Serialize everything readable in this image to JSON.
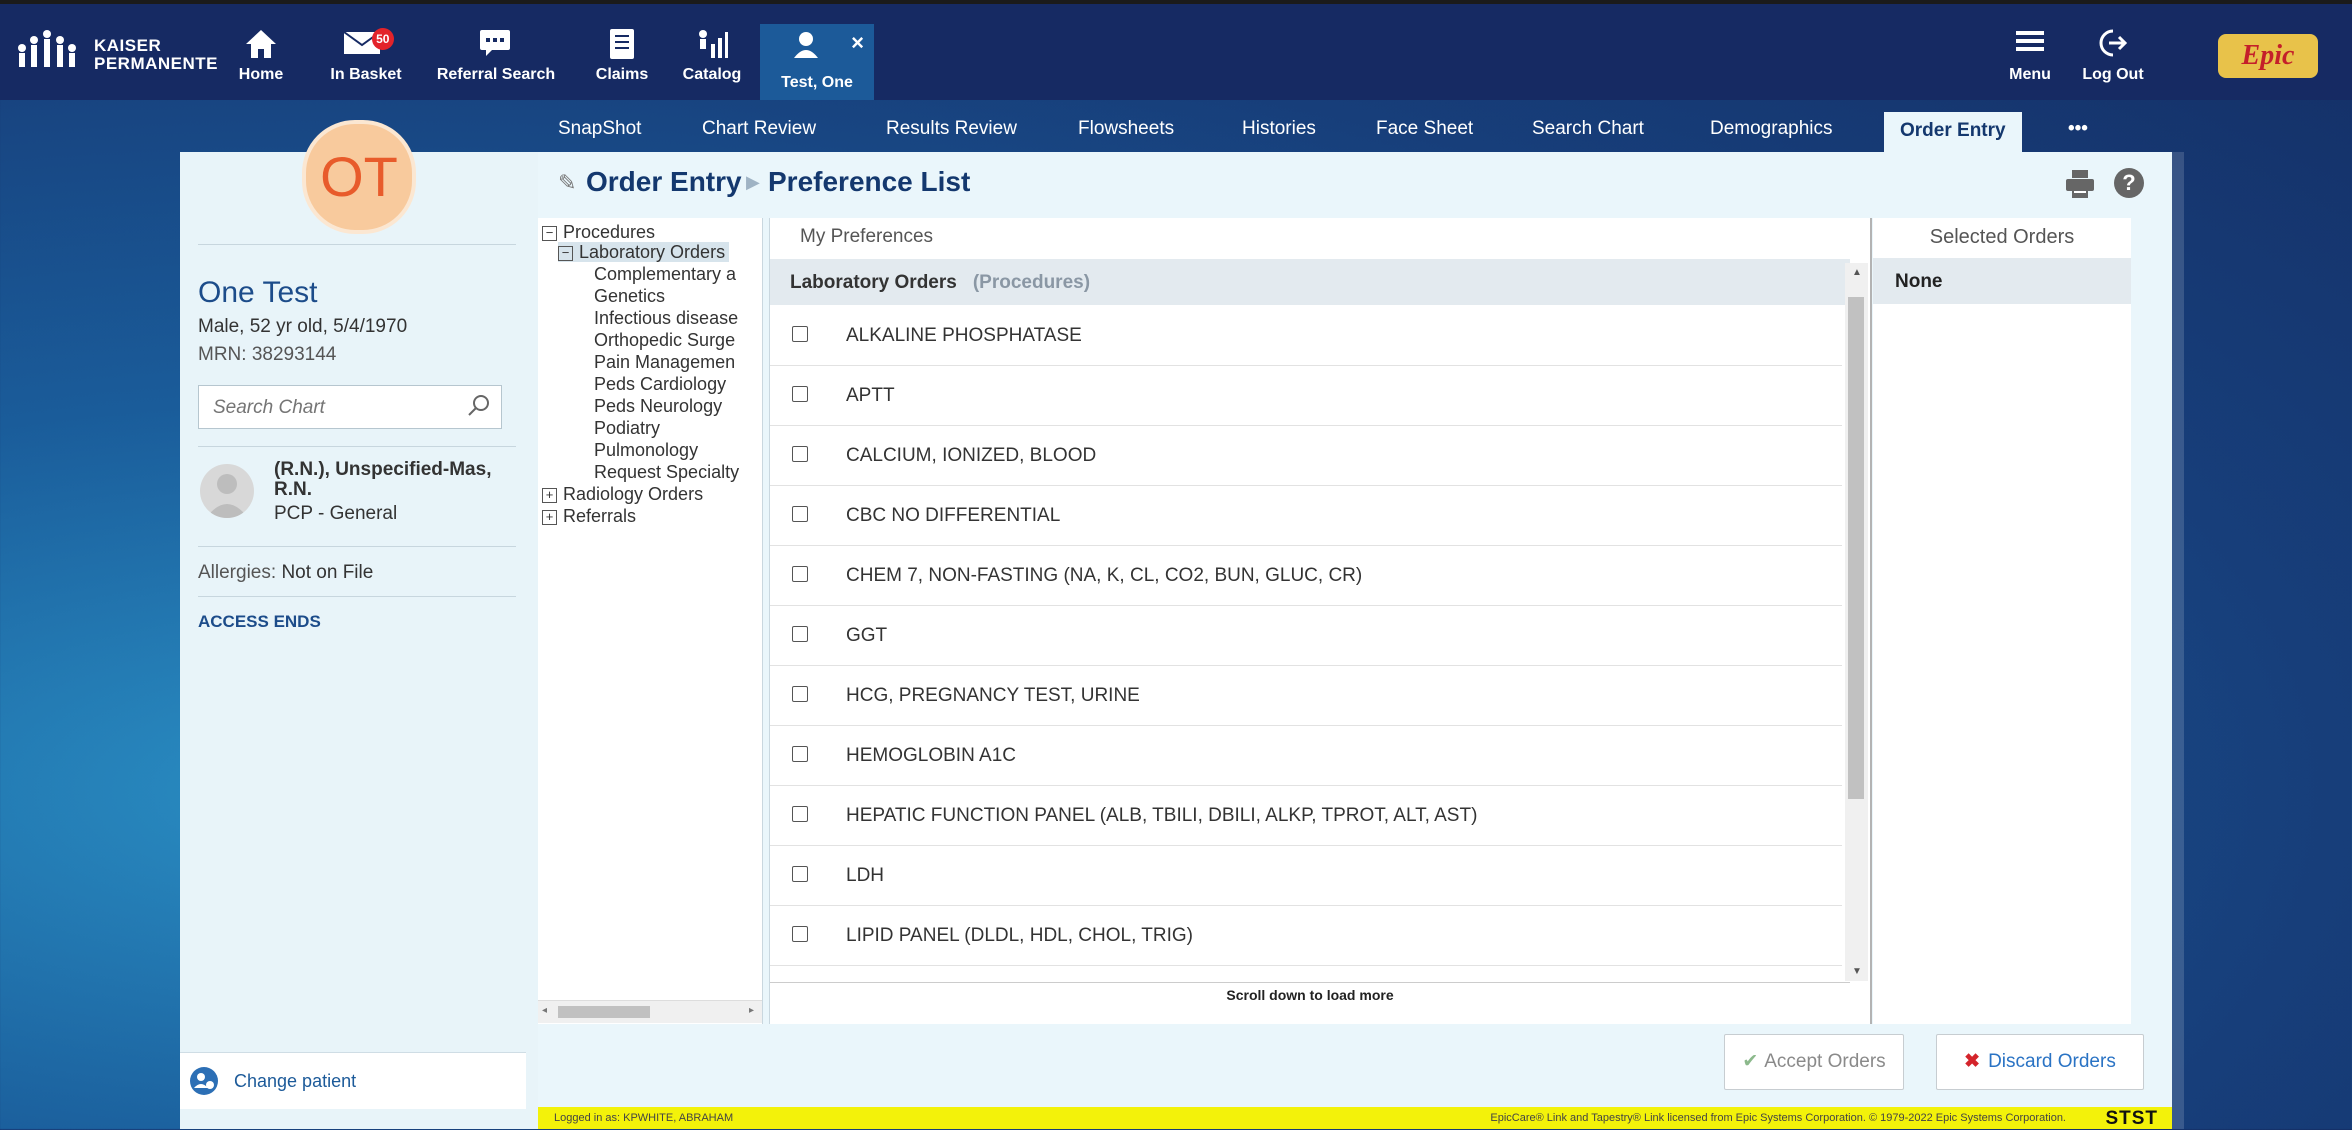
{
  "logo": {
    "line1": "KAISER",
    "line2": "PERMANENTE"
  },
  "topnav": {
    "home": "Home",
    "in_basket": "In Basket",
    "in_basket_count": "50",
    "referral_search": "Referral Search",
    "claims": "Claims",
    "catalog": "Catalog",
    "patient_tab": "Test, One",
    "menu": "Menu",
    "log_out": "Log Out",
    "epic": "Epic"
  },
  "tabs": [
    "SnapShot",
    "Chart Review",
    "Results Review",
    "Flowsheets",
    "Histories",
    "Face Sheet",
    "Search Chart",
    "Demographics",
    "Order Entry",
    "•••"
  ],
  "patient": {
    "initials": "OT",
    "name": "One Test",
    "demographics": "Male, 52 yr old, 5/4/1970",
    "mrn": "MRN: 38293144",
    "search_placeholder": "Search Chart",
    "pcp_name": "(R.N.), Unspecified-Mas, R.N.",
    "pcp_role": "PCP - General",
    "allergies_label": "Allergies:",
    "allergies_value": "Not on File",
    "access_ends": "ACCESS ENDS",
    "change_patient": "Change patient"
  },
  "breadcrumb": {
    "root": "Order Entry",
    "current": "Preference List"
  },
  "tree": {
    "procedures": "Procedures",
    "laboratory_orders": "Laboratory Orders",
    "children": [
      "Complementary a",
      "Genetics",
      "Infectious disease",
      "Orthopedic Surge",
      "Pain Managemen",
      "Peds Cardiology",
      "Peds Neurology",
      "Podiatry",
      "Pulmonology",
      "Request Specialty"
    ],
    "radiology_orders": "Radiology Orders",
    "referrals": "Referrals"
  },
  "list": {
    "my_preferences": "My Preferences",
    "header": "Laboratory Orders",
    "header_sub": "(Procedures)",
    "items": [
      "ALKALINE PHOSPHATASE",
      "APTT",
      "CALCIUM, IONIZED, BLOOD",
      "CBC NO DIFFERENTIAL",
      "CHEM 7, NON-FASTING (NA, K, CL, CO2, BUN, GLUC, CR)",
      "GGT",
      "HCG, PREGNANCY TEST, URINE",
      "HEMOGLOBIN A1C",
      "HEPATIC FUNCTION PANEL (ALB, TBILI, DBILI, ALKP, TPROT, ALT, AST)",
      "LDH",
      "LIPID PANEL (DLDL, HDL, CHOL, TRIG)"
    ],
    "scroll_more": "Scroll down to load more"
  },
  "selected": {
    "title": "Selected Orders",
    "none": "None"
  },
  "buttons": {
    "accept": "Accept Orders",
    "discard": "Discard Orders"
  },
  "footer": {
    "logged_in": "Logged in as: KPWHITE, ABRAHAM",
    "copyright": "EpicCare® Link and Tapestry® Link licensed from Epic Systems Corporation. © 1979-2022 Epic Systems Corporation.",
    "env": "STST"
  },
  "colors": {
    "topbar": "#162a63",
    "tabbar": "#1c5a99",
    "accent": "#14386e",
    "footer": "#f3f20a"
  }
}
